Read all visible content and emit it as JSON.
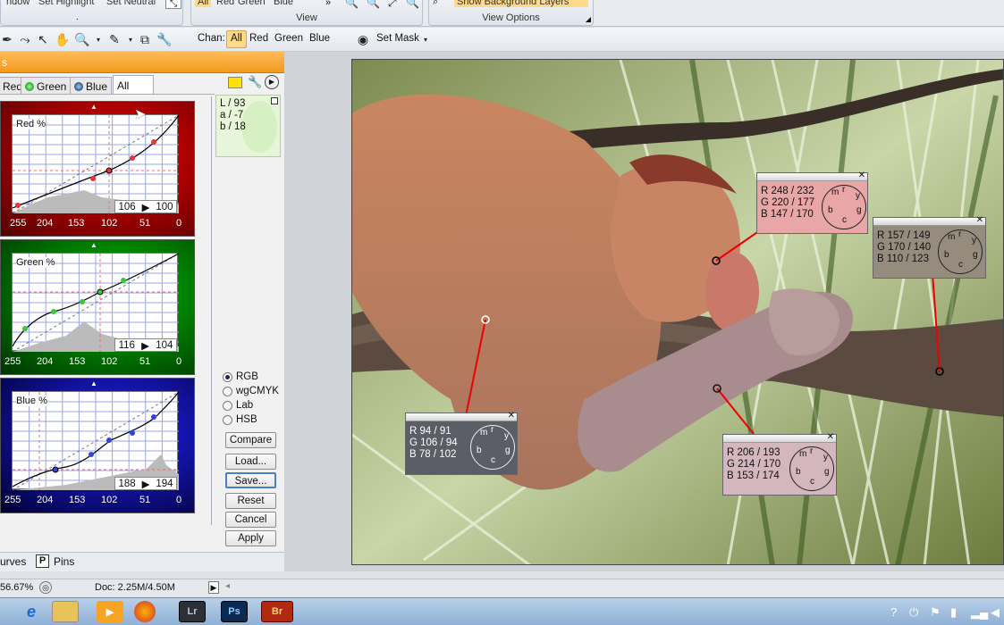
{
  "ribbon": {
    "left_partial_1": "ndow",
    "left_partial_2": "Set Highlight",
    "left_partial_3": "Set Neutral",
    "view_group_label": "View",
    "view_options_label": "View Options",
    "chan_buttons": [
      "All",
      "Red",
      "Green",
      "Blue"
    ],
    "show_bg_layers": "Show Background Layers"
  },
  "toolbar": {
    "chan_label": "Chan:",
    "channels": [
      "All",
      "Red",
      "Green",
      "Blue"
    ],
    "active_channel": "All",
    "set_mask": "Set Mask"
  },
  "panel": {
    "title": "s",
    "tabs": [
      "Red",
      "Green",
      "Blue",
      "All"
    ],
    "active_tab": "All",
    "lab_readout": {
      "L": "L /   93",
      "a": "a /   -7",
      "b": "b /  18"
    },
    "curves": [
      {
        "label": "Red %",
        "in": "106",
        "out": "100",
        "color": "#c40000"
      },
      {
        "label": "Green %",
        "in": "116",
        "out": "104",
        "color": "#00a000"
      },
      {
        "label": "Blue %",
        "in": "188",
        "out": "194",
        "color": "#0000c0"
      }
    ],
    "ticks": [
      "255",
      "204",
      "153",
      "102",
      "51",
      "0"
    ],
    "color_modes": [
      "RGB",
      "wgCMYK",
      "Lab",
      "HSB"
    ],
    "selected_mode": "RGB",
    "buttons": [
      "Compare",
      "Load...",
      "Save...",
      "Reset",
      "Cancel",
      "Apply"
    ],
    "bottom_tabs": [
      "urves",
      "Pins"
    ]
  },
  "samplers": [
    {
      "rows": [
        "R 248 / 232",
        "G 220 / 177",
        "B 147 / 170"
      ],
      "bg": "#e9a6a6"
    },
    {
      "rows": [
        "R 157 / 149",
        "G 170 / 140",
        "B 110 / 123"
      ],
      "bg": "#958c7d"
    },
    {
      "rows": [
        "R  94 /  91",
        "G 106 /  94",
        "B  78 / 102"
      ],
      "bg": "#5b5e66"
    },
    {
      "rows": [
        "R 206 / 193",
        "G 214 / 170",
        "B 153 / 174"
      ],
      "bg": "#d3b6be"
    }
  ],
  "wheel_letters": [
    "r",
    "y",
    "g",
    "c",
    "b",
    "m"
  ],
  "status": {
    "zoom": "56.67%",
    "doc": "Doc: 2.25M/4.50M"
  },
  "taskbar": {
    "apps": [
      "e",
      "",
      "",
      "",
      "Lr",
      "Ps",
      "Br"
    ]
  },
  "colors": {
    "accent": "#f29a1e",
    "taskbar": "#8fb0d6"
  }
}
